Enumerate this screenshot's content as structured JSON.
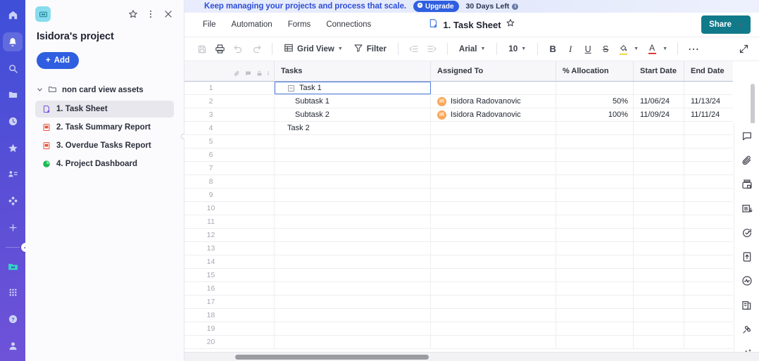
{
  "left_rail": {
    "items": [
      {
        "name": "home-icon",
        "selected": false
      },
      {
        "name": "bell-icon",
        "selected": true
      },
      {
        "name": "search-icon",
        "selected": false
      },
      {
        "name": "folder-icon",
        "selected": false
      },
      {
        "name": "clock-icon",
        "selected": false
      },
      {
        "name": "star-icon",
        "selected": false
      },
      {
        "name": "people-icon",
        "selected": false
      },
      {
        "name": "apps-grid-icon",
        "selected": false
      },
      {
        "name": "plus-icon",
        "selected": false
      }
    ],
    "workspace_icon": "workspace-icon",
    "bottom": [
      {
        "name": "grid-apps-icon"
      },
      {
        "name": "help-icon"
      },
      {
        "name": "account-avatar-icon"
      }
    ]
  },
  "sidebar": {
    "project_icon": "project-cube-icon",
    "favorite_icon": "star-outline-icon",
    "more_icon": "kebab-menu-icon",
    "close_icon": "close-icon",
    "title": "Isidora's project",
    "add_label": "Add",
    "folder": {
      "label": "non card view assets",
      "expanded": true
    },
    "items": [
      {
        "label": "1. Task Sheet",
        "icon": "sheet-icon",
        "color": "#7b4fe0",
        "active": true
      },
      {
        "label": "2. Task Summary Report",
        "icon": "report-icon",
        "color": "#e8563f",
        "active": false
      },
      {
        "label": "3. Overdue Tasks Report",
        "icon": "report-icon",
        "color": "#e8563f",
        "active": false
      },
      {
        "label": "4. Project Dashboard",
        "icon": "dashboard-icon",
        "color": "#1db954",
        "active": false
      }
    ]
  },
  "promo": {
    "text": "Keep managing your projects and process that scale.",
    "upgrade_label": "Upgrade",
    "days_left": "30 Days Left",
    "info_glyph": "i"
  },
  "menubar": {
    "items": [
      "File",
      "Automation",
      "Forms",
      "Connections"
    ],
    "doc_icon": "sheet-doc-icon",
    "doc_title": "1. Task Sheet",
    "doc_star_icon": "star-outline-icon",
    "share_label": "Share",
    "share_color": "#117a8a"
  },
  "toolbar": {
    "save_icon": "save-icon",
    "print_icon": "print-icon",
    "undo_icon": "undo-icon",
    "redo_icon": "redo-icon",
    "view_icon": "grid-view-icon",
    "view_label": "Grid View",
    "filter_icon": "filter-icon",
    "filter_label": "Filter",
    "outdent_icon": "outdent-icon",
    "indent_icon": "indent-icon",
    "font_family": "Arial",
    "font_size": "10",
    "bold_label": "B",
    "italic_label": "I",
    "underline_label": "U",
    "strike_label": "S",
    "fill_color_icon": "fill-color-icon",
    "fill_color": "#f5d547",
    "text_color_label": "A",
    "text_color": "#e03b2f",
    "more_label": "⋯",
    "expand_icon": "expand-icon"
  },
  "grid": {
    "gutter_icons": [
      "attachment-icon",
      "comment-icon",
      "lock-icon",
      "info-icon"
    ],
    "columns": [
      {
        "key": "tasks",
        "label": "Tasks",
        "align": "left"
      },
      {
        "key": "assigned",
        "label": "Assigned To",
        "align": "left"
      },
      {
        "key": "alloc",
        "label": "% Allocation",
        "align": "left"
      },
      {
        "key": "start",
        "label": "Start Date",
        "align": "left"
      },
      {
        "key": "end",
        "label": "End Date",
        "align": "left"
      }
    ],
    "rows": [
      {
        "n": "1",
        "task": "Task 1",
        "level": 0,
        "collapse": "−",
        "selected": true,
        "assigned": "",
        "initials": "",
        "alloc": "",
        "start": "",
        "end": ""
      },
      {
        "n": "2",
        "task": "Subtask 1",
        "level": 1,
        "collapse": "",
        "selected": false,
        "assigned": "Isidora Radovanovic",
        "initials": "IR",
        "alloc": "50%",
        "start": "11/06/24",
        "end": "11/13/24"
      },
      {
        "n": "3",
        "task": "Subtask 2",
        "level": 1,
        "collapse": "",
        "selected": false,
        "assigned": "Isidora Radovanovic",
        "initials": "IR",
        "alloc": "100%",
        "start": "11/09/24",
        "end": "11/11/24"
      },
      {
        "n": "4",
        "task": "Task 2",
        "level": 0,
        "collapse": "",
        "selected": false,
        "assigned": "",
        "initials": "",
        "alloc": "",
        "start": "",
        "end": ""
      },
      {
        "n": "5",
        "task": "",
        "level": 0,
        "collapse": "",
        "selected": false,
        "assigned": "",
        "initials": "",
        "alloc": "",
        "start": "",
        "end": ""
      },
      {
        "n": "6",
        "task": "",
        "level": 0,
        "collapse": "",
        "selected": false,
        "assigned": "",
        "initials": "",
        "alloc": "",
        "start": "",
        "end": ""
      },
      {
        "n": "7",
        "task": "",
        "level": 0,
        "collapse": "",
        "selected": false,
        "assigned": "",
        "initials": "",
        "alloc": "",
        "start": "",
        "end": ""
      },
      {
        "n": "8",
        "task": "",
        "level": 0,
        "collapse": "",
        "selected": false,
        "assigned": "",
        "initials": "",
        "alloc": "",
        "start": "",
        "end": ""
      },
      {
        "n": "9",
        "task": "",
        "level": 0,
        "collapse": "",
        "selected": false,
        "assigned": "",
        "initials": "",
        "alloc": "",
        "start": "",
        "end": ""
      },
      {
        "n": "10",
        "task": "",
        "level": 0,
        "collapse": "",
        "selected": false,
        "assigned": "",
        "initials": "",
        "alloc": "",
        "start": "",
        "end": ""
      },
      {
        "n": "11",
        "task": "",
        "level": 0,
        "collapse": "",
        "selected": false,
        "assigned": "",
        "initials": "",
        "alloc": "",
        "start": "",
        "end": ""
      },
      {
        "n": "12",
        "task": "",
        "level": 0,
        "collapse": "",
        "selected": false,
        "assigned": "",
        "initials": "",
        "alloc": "",
        "start": "",
        "end": ""
      },
      {
        "n": "13",
        "task": "",
        "level": 0,
        "collapse": "",
        "selected": false,
        "assigned": "",
        "initials": "",
        "alloc": "",
        "start": "",
        "end": ""
      },
      {
        "n": "14",
        "task": "",
        "level": 0,
        "collapse": "",
        "selected": false,
        "assigned": "",
        "initials": "",
        "alloc": "",
        "start": "",
        "end": ""
      },
      {
        "n": "15",
        "task": "",
        "level": 0,
        "collapse": "",
        "selected": false,
        "assigned": "",
        "initials": "",
        "alloc": "",
        "start": "",
        "end": ""
      },
      {
        "n": "16",
        "task": "",
        "level": 0,
        "collapse": "",
        "selected": false,
        "assigned": "",
        "initials": "",
        "alloc": "",
        "start": "",
        "end": ""
      },
      {
        "n": "17",
        "task": "",
        "level": 0,
        "collapse": "",
        "selected": false,
        "assigned": "",
        "initials": "",
        "alloc": "",
        "start": "",
        "end": ""
      },
      {
        "n": "18",
        "task": "",
        "level": 0,
        "collapse": "",
        "selected": false,
        "assigned": "",
        "initials": "",
        "alloc": "",
        "start": "",
        "end": ""
      },
      {
        "n": "19",
        "task": "",
        "level": 0,
        "collapse": "",
        "selected": false,
        "assigned": "",
        "initials": "",
        "alloc": "",
        "start": "",
        "end": ""
      },
      {
        "n": "20",
        "task": "",
        "level": 0,
        "collapse": "",
        "selected": false,
        "assigned": "",
        "initials": "",
        "alloc": "",
        "start": "",
        "end": ""
      }
    ]
  },
  "right_rail": {
    "items": [
      {
        "name": "conversation-icon"
      },
      {
        "name": "attachment-icon"
      },
      {
        "name": "proof-icon"
      },
      {
        "name": "baseline-icon"
      },
      {
        "name": "update-request-icon"
      },
      {
        "name": "publish-icon"
      },
      {
        "name": "activity-log-icon"
      },
      {
        "name": "summary-icon"
      },
      {
        "name": "connections-icon"
      },
      {
        "name": "sparkle-ai-icon"
      }
    ]
  }
}
